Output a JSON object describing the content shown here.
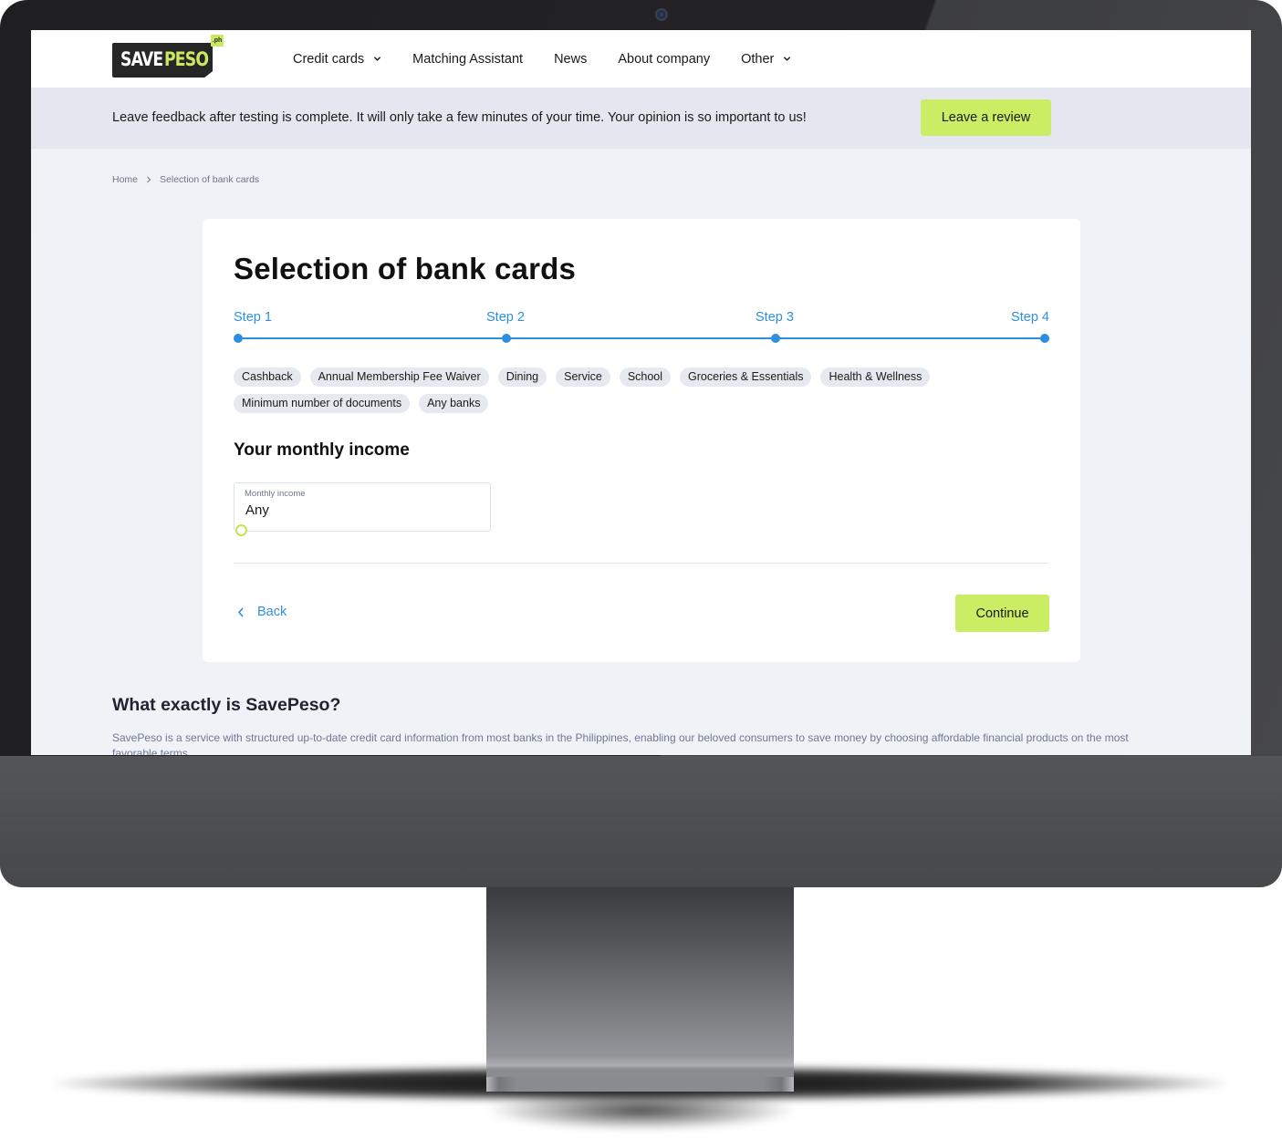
{
  "brand": {
    "logo_word_1": "SAVE",
    "logo_word_2": "PESO",
    "logo_badge": ".ph",
    "accent_color": "#cbed63",
    "link_color": "#2d8fe0"
  },
  "nav": {
    "items": [
      {
        "label": "Credit cards",
        "has_dropdown": true
      },
      {
        "label": "Matching Assistant",
        "has_dropdown": false
      },
      {
        "label": "News",
        "has_dropdown": false
      },
      {
        "label": "About company",
        "has_dropdown": false
      },
      {
        "label": "Other",
        "has_dropdown": true
      }
    ]
  },
  "banner": {
    "text": "Leave feedback after testing is complete. It will only take a few minutes of your time. Your opinion is so important to us!",
    "button_label": "Leave a review"
  },
  "breadcrumb": {
    "items": [
      "Home",
      "Selection of bank cards"
    ]
  },
  "wizard": {
    "title": "Selection of bank cards",
    "steps": [
      "Step 1",
      "Step 2",
      "Step 3",
      "Step 4"
    ],
    "chips_row_1": [
      "Cashback",
      "Annual Membership Fee Waiver",
      "Dining",
      "Service",
      "School",
      "Groceries & Essentials",
      "Health & Wellness"
    ],
    "chips_row_2": [
      "Minimum number of documents",
      "Any banks"
    ],
    "section_title": "Your monthly income",
    "income_field": {
      "label": "Monthly income",
      "value": "Any",
      "slider_fraction": 0
    },
    "back_label": "Back",
    "continue_label": "Continue"
  },
  "about": {
    "title": "What exactly is SavePeso?",
    "text": "SavePeso is a service with structured up-to-date credit card information from most banks in the Philippines, enabling our beloved consumers to save money by choosing affordable financial products on the most favorable terms."
  }
}
